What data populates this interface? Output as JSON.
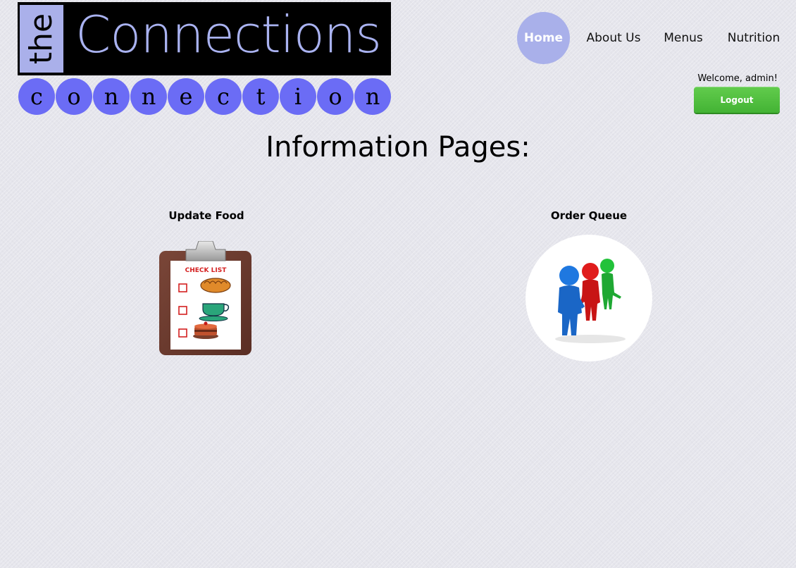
{
  "logo": {
    "the": "the",
    "connections": "Connections",
    "letters": [
      "c",
      "o",
      "n",
      "n",
      "e",
      "c",
      "t",
      "i",
      "o",
      "n"
    ]
  },
  "nav": {
    "home": "Home",
    "about": "About Us",
    "menus": "Menus",
    "nutrition": "Nutrition"
  },
  "user": {
    "welcome": "Welcome, admin!",
    "logout": "Logout"
  },
  "main": {
    "title": "Information Pages:",
    "cards": [
      {
        "label": "Update Food",
        "icon": "checklist-clipboard-icon",
        "image_text": "CHECK LIST"
      },
      {
        "label": "Order Queue",
        "icon": "team-people-icon"
      }
    ]
  },
  "colors": {
    "background": "#e5e5ec",
    "accent": "#a9b0ea",
    "logo_circles": "#6b6cf5",
    "logout_green": "#4cbc3c"
  }
}
